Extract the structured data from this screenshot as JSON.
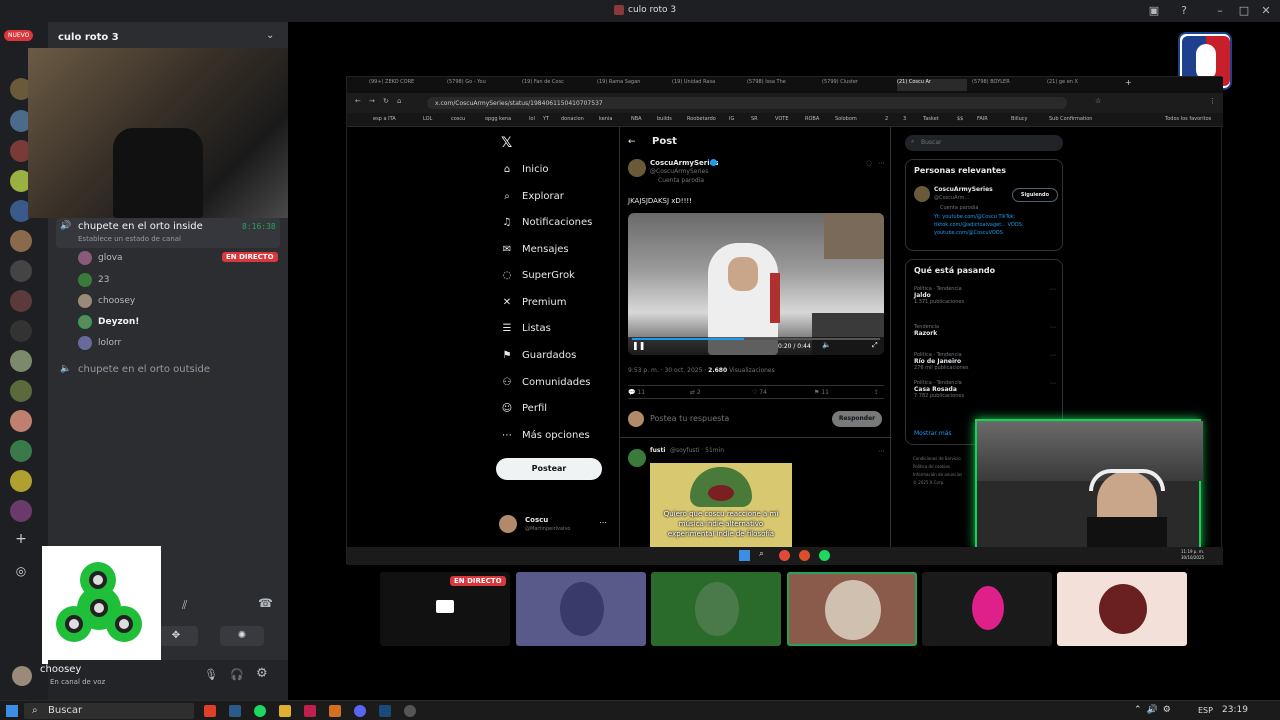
{
  "window": {
    "title": "culo roto 3"
  },
  "discord": {
    "server_name": "culo roto 3",
    "new_badge": "NUEVO",
    "voice_channel": {
      "name": "chupete en el orto inside",
      "timer": "8:16:38",
      "status_hint": "Establece un estado de canal",
      "live_badge": "EN DIRECTO",
      "members": [
        "glova",
        "23",
        "choosey",
        "Deyzon!",
        "lolorr"
      ]
    },
    "other_channel": "chupete en el orto outside",
    "user": {
      "name": "choosey",
      "status": "En canal de voz"
    }
  },
  "browser": {
    "tabs": [
      "(99+) ZEKO CORE",
      "(5798) Go - You",
      "(19) Fan de Cosc",
      "(19) Rama Sagan",
      "(19) Unidad Rasa",
      "(5798) Issa The",
      "(5799) Cluster",
      "(21) Coscu Ar",
      "(5798) BOYLER",
      "(21) ge en X"
    ],
    "url": "x.com/CoscuArmySeries/status/1984061150410707537",
    "bookmarks": [
      "esp a ITA",
      "LOL",
      "coscu",
      "opgg kena",
      "lol",
      "YT",
      "donacion",
      "kenia",
      "NBA",
      "builds",
      "Roobetardo",
      "IG",
      "SR",
      "VOTE",
      "ROBA",
      "Solobom",
      "2",
      "3",
      "Tasket",
      "$$",
      "FAIR",
      "Billucy",
      "Sub Confirmation",
      "Todos los favoritos"
    ]
  },
  "x": {
    "nav": [
      "Inicio",
      "Explorar",
      "Notificaciones",
      "Mensajes",
      "SuperGrok",
      "Premium",
      "Listas",
      "Guardados",
      "Comunidades",
      "Perfil",
      "Más opciones"
    ],
    "post_button": "Postear",
    "account": {
      "name": "Coscu",
      "handle": "@Martinpeirlvalvo"
    },
    "header": "Post",
    "tweet": {
      "author": "CoscuArmySeries",
      "handle": "@CoscuArmySeries",
      "parody": "Cuenta parodia",
      "text": "JKAJSJDAKSJ xD!!!!",
      "video_time": "0:20 / 0:44",
      "timestamp": "9:53 p. m. · 30 oct. 2025 ·",
      "views": "2.680",
      "views_label": "Visualizaciones",
      "stats": {
        "replies": "11",
        "reposts": "2",
        "likes": "74",
        "bookmarks": "11"
      }
    },
    "reply_placeholder": "Postea tu respuesta",
    "reply_button": "Responder",
    "reply": {
      "author": "fusti",
      "handle": "@soyfusti · 51min",
      "image_text": "Quiero que coscu reaccione a mi música indie alternativo experimental indie de filosofía"
    },
    "search_placeholder": "Buscar",
    "relevant": {
      "title": "Personas relevantes",
      "name": "CoscuArmySeries",
      "handle": "@CoscuArm...",
      "follow": "Siguiendo",
      "bio1": "Cuenta parodia",
      "bio2": "Yt: youtube.com/@Coscu TikTok:",
      "bio3": "tiktok.com/@adictoalvaget... VODS:",
      "bio4": "youtube.com/@CoscuVODS"
    },
    "trending": {
      "title": "Qué está pasando",
      "items": [
        {
          "meta": "Política · Tendencia",
          "name": "Jaldo",
          "count": "1.371 publicaciones"
        },
        {
          "meta": "Tendencia",
          "name": "Razork",
          "count": ""
        },
        {
          "meta": "Política · Tendencia",
          "name": "Río de Janeiro",
          "count": "276 mil publicaciones"
        },
        {
          "meta": "Política · Tendencia",
          "name": "Casa Rosada",
          "count": "7.782 publicaciones"
        }
      ],
      "more": "Mostrar más"
    },
    "footer": [
      "Condiciones de Servicio",
      "Política de cookies",
      "Información de anuncios",
      "© 2025 X Corp."
    ]
  },
  "stream_clock": {
    "time": "11:19 p. m.",
    "date": "30/10/2025"
  },
  "thumbnail_live": "EN DIRECTO",
  "taskbar": {
    "search": "Buscar",
    "lang": "ESP",
    "time": "23:19"
  }
}
